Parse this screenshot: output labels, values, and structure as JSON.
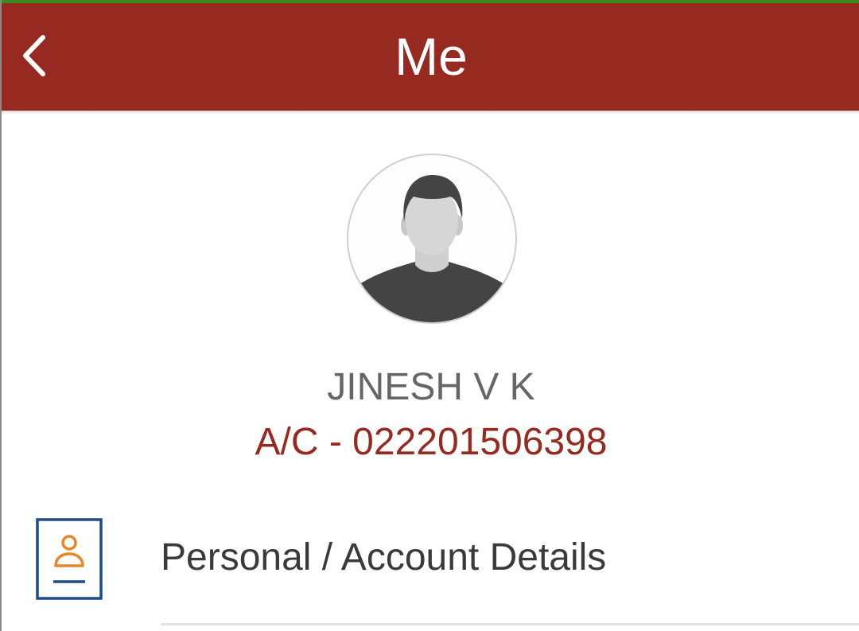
{
  "header": {
    "title": "Me",
    "back_icon": "chevron-left-icon",
    "background_color": "#962a20",
    "status_strip_color": "#3a8a1e"
  },
  "profile": {
    "avatar_icon": "default-user-avatar",
    "name": "JINESH V K",
    "account": "A/C - 022201506398",
    "name_color": "#666666",
    "account_color": "#962a20"
  },
  "menu": {
    "items": [
      {
        "label": "Personal / Account Details",
        "icon": "user-profile-card-icon",
        "icon_frame_color": "#1d4a8a",
        "icon_accent_color": "#e8862a"
      }
    ]
  }
}
